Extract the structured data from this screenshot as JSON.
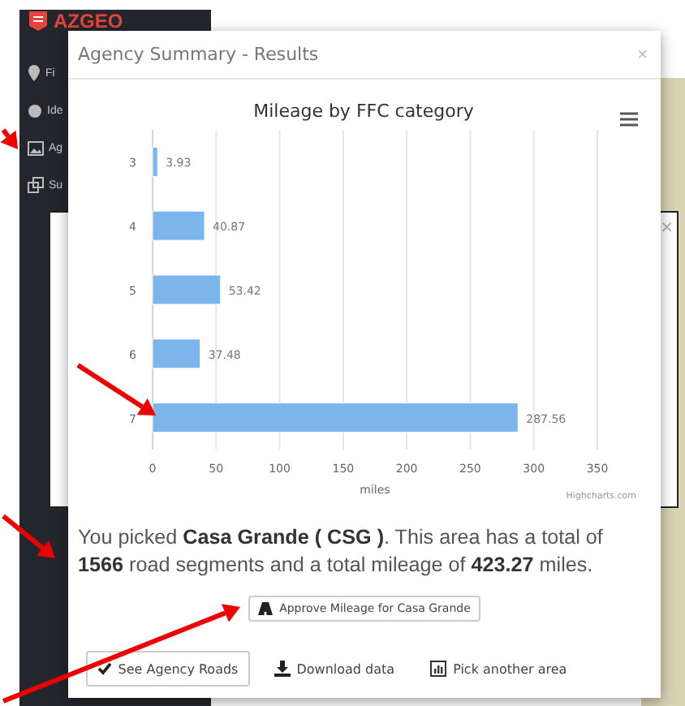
{
  "app": {
    "logo": "AZGEO",
    "sidebar_items": [
      {
        "label": "Fi"
      },
      {
        "label": "Ide"
      },
      {
        "label": "Ag"
      },
      {
        "label": "Su"
      }
    ]
  },
  "background_dialog": {
    "close": "×"
  },
  "modal": {
    "title": "Agency Summary - Results",
    "close": "×",
    "chart_data": {
      "type": "bar",
      "orientation": "horizontal",
      "title": "Mileage by FFC category",
      "xlabel": "miles",
      "categories": [
        "3",
        "4",
        "5",
        "6",
        "7"
      ],
      "grid": true,
      "series": [
        {
          "color": "#7cb5ec",
          "values": [
            3.93,
            40.87,
            53.42,
            37.48,
            287.56
          ]
        }
      ],
      "xlim": [
        0,
        350
      ],
      "xticks": [
        0,
        50,
        100,
        150,
        200,
        250,
        300,
        350
      ],
      "data_labels": true
    },
    "credits": "Highcharts.com",
    "summary": "You picked **Casa Grande ( CSG )**. This area has a total of **1566** road segments and a total mileage of **423.27** miles.",
    "approve_button": "Approve Mileage for Casa Grande",
    "actions": [
      {
        "label": "See Agency Roads",
        "kind": "check",
        "bordered": true
      },
      {
        "label": "Download data",
        "kind": "download",
        "bordered": false
      },
      {
        "label": "Pick another area",
        "kind": "chart",
        "bordered": false
      }
    ]
  }
}
